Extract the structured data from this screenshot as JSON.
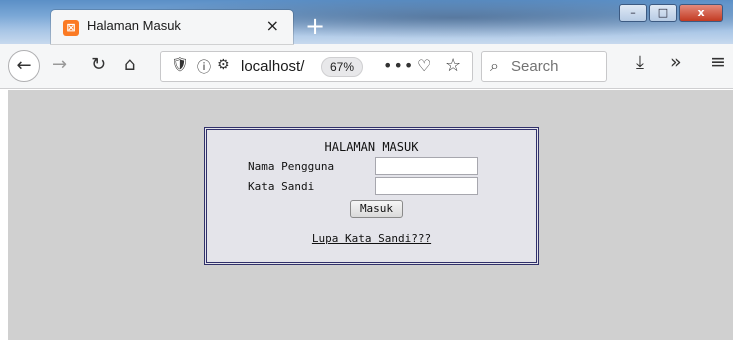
{
  "browser": {
    "tab": {
      "title": "Halaman Masuk",
      "favicon": "xampp-icon",
      "close": "×"
    },
    "new_tab": "+",
    "window_controls": {
      "minimize": "–",
      "maximize": "□",
      "close": "x"
    },
    "nav": {
      "back": "←",
      "forward": "→",
      "reload": "↻",
      "home": "⌂"
    },
    "urlbar": {
      "shield": "🛡",
      "info": "ⓘ",
      "permissions": "⚙",
      "url": "localhost/",
      "zoom": "67%",
      "page_actions": "•••",
      "pocket": "♡",
      "bookmark": "☆"
    },
    "search": {
      "placeholder": "Search",
      "icon": "⌕"
    },
    "toolbar": {
      "download": "⤓",
      "overflow": "»",
      "menu": "≡"
    }
  },
  "page": {
    "background": "#d0d0d0",
    "login": {
      "title": "HALAMAN MASUK",
      "username_label": "Nama Pengguna",
      "password_label": "Kata Sandi",
      "username_value": "",
      "password_value": "",
      "submit_label": "Masuk",
      "forgot_link": "Lupa Kata Sandi???"
    }
  }
}
